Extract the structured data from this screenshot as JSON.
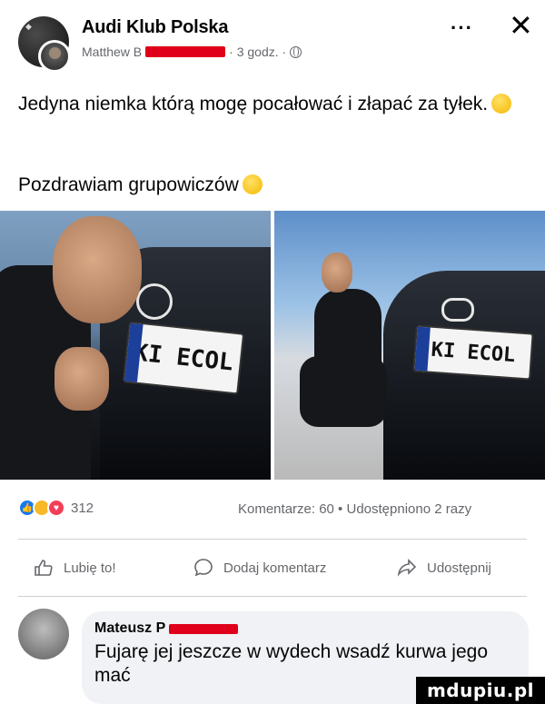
{
  "header": {
    "group_name": "Audi Klub Polska",
    "author_prefix": "Matthew B",
    "time": "· 3 godz. ·",
    "more_label": "···",
    "close_label": "✕"
  },
  "post": {
    "text_line1": "Jedyna niemka którą mogę pocałować i złapać za tyłek.",
    "text_line2": "Pozdrawiam grupowiczów",
    "photo_left": {
      "plate_text": "KI ECOL"
    },
    "photo_right": {
      "plate_text": "KI ECOL"
    }
  },
  "stats": {
    "reactions": [
      "like",
      "haha",
      "love"
    ],
    "reaction_count": "312",
    "comments_shares": "Komentarze: 60 • Udostępniono 2 razy"
  },
  "actions": {
    "like_label": "Lubię to!",
    "comment_label": "Dodaj komentarz",
    "share_label": "Udostępnij"
  },
  "comment": {
    "author": "Mateusz P",
    "text": "Fujarę jej jeszcze w wydech wsadź kurwa jego mać"
  },
  "watermark": "mdupiu.pl",
  "colors": {
    "link_gray": "#65676b",
    "redaction": "#e0001b",
    "bubble": "#f0f2f5",
    "like_blue": "#1877f2"
  }
}
